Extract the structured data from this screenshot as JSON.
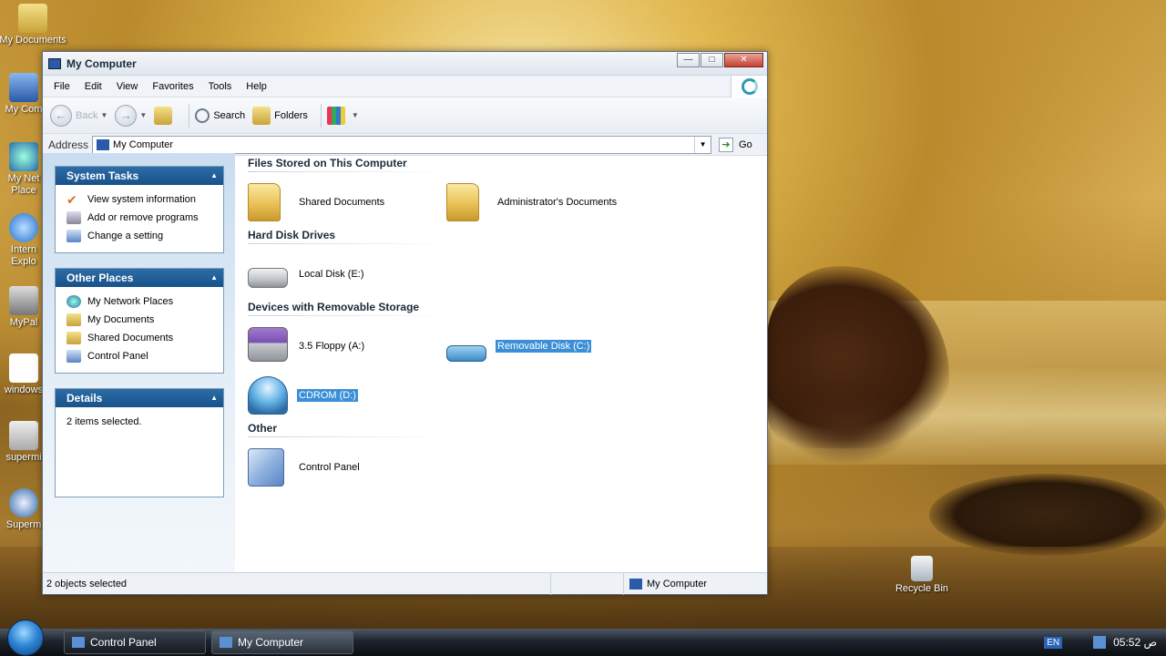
{
  "desktop": {
    "icons": [
      {
        "label": "My Documents"
      },
      {
        "label": "My Com"
      },
      {
        "label": "My Net"
      },
      {
        "label": "Place"
      },
      {
        "label": "Intern"
      },
      {
        "label": "Explo"
      },
      {
        "label": "MyPal"
      },
      {
        "label": "windows"
      },
      {
        "label": "supermi"
      },
      {
        "label": "Superm"
      }
    ],
    "recycle_bin": "Recycle Bin"
  },
  "window": {
    "title": "My Computer",
    "menu": [
      "File",
      "Edit",
      "View",
      "Favorites",
      "Tools",
      "Help"
    ],
    "toolbar": {
      "back": "Back",
      "search": "Search",
      "folders": "Folders"
    },
    "address": {
      "label": "Address",
      "value": "My Computer",
      "go": "Go"
    },
    "system_tasks": {
      "title": "System Tasks",
      "items": [
        "View system information",
        "Add or remove programs",
        "Change a setting"
      ]
    },
    "other_places": {
      "title": "Other Places",
      "items": [
        "My Network Places",
        "My Documents",
        "Shared Documents",
        "Control Panel"
      ]
    },
    "details": {
      "title": "Details",
      "text": "2 items selected."
    },
    "groups": {
      "files_stored": "Files Stored on This Computer",
      "hard_disk": "Hard Disk Drives",
      "removable": "Devices with Removable Storage",
      "other": "Other"
    },
    "items": {
      "shared_documents": "Shared Documents",
      "admin_documents": "Administrator's Documents",
      "local_disk": "Local Disk (E:)",
      "floppy": "3.5 Floppy (A:)",
      "removable_disk": "Removable Disk (C:)",
      "cdrom": "CDROM (D:)",
      "control_panel": "Control Panel"
    },
    "status": {
      "left": "2 objects selected",
      "right": "My Computer"
    }
  },
  "taskbar": {
    "buttons": [
      "Control Panel",
      "My Computer"
    ],
    "lang": "EN",
    "clock": "05:52 ص"
  }
}
